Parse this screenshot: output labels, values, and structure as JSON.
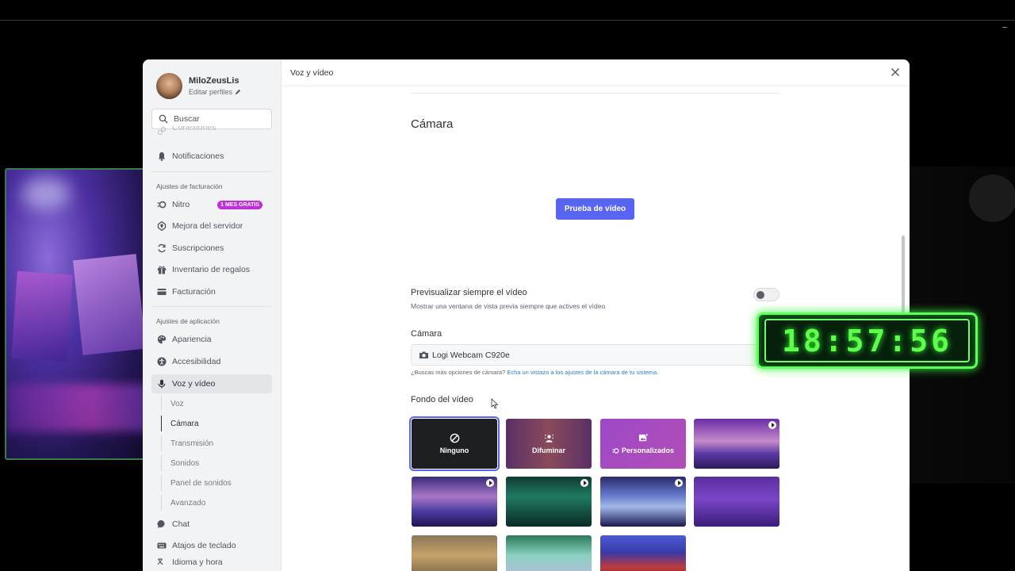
{
  "clock": {
    "time": "18:57:56"
  },
  "profile": {
    "name": "MiloZeusLis",
    "edit_label": "Editar perfiles"
  },
  "search": {
    "placeholder": "Buscar"
  },
  "sidebar": {
    "partial_item": "Conexiones",
    "notifications": "Notificaciones",
    "billing_section": "Ajustes de facturación",
    "billing_items": [
      {
        "label": "Nitro",
        "badge": "1 MES GRATIS"
      },
      {
        "label": "Mejora del servidor"
      },
      {
        "label": "Suscripciones"
      },
      {
        "label": "Inventario de regalos"
      },
      {
        "label": "Facturación"
      }
    ],
    "app_section": "Ajustes de aplicación",
    "app_items": [
      {
        "label": "Apariencia"
      },
      {
        "label": "Accesibilidad"
      },
      {
        "label": "Voz y vídeo"
      }
    ],
    "sub_items": [
      "Voz",
      "Cámara",
      "Transmisión",
      "Sonidos",
      "Panel de sonidos",
      "Avanzado"
    ],
    "more_items": [
      "Chat",
      "Atajos de teclado",
      "Idioma y hora"
    ]
  },
  "content": {
    "header": "Voz y vídeo",
    "camera_title": "Cámara",
    "test_button": "Prueba de vídeo",
    "preview_always_title": "Previsualizar siempre el vídeo",
    "preview_always_desc": "Mostrar una ventana de vista previa siempre que actives el vídeo",
    "preview_always_on": false,
    "camera_label": "Cámara",
    "camera_value": "Logi Webcam C920e",
    "hint_text": "¿Buscas más opciones de cámara?",
    "hint_link": "Echa un vistazo a los ajustes de la cámara de tu sistema.",
    "background_label": "Fondo del vídeo",
    "backgrounds": [
      {
        "label": "Ninguno",
        "selected": true
      },
      {
        "label": "Difuminar"
      },
      {
        "label": "Personalizados"
      }
    ]
  },
  "colors": {
    "accent": "#5865f2",
    "nitro_badge": "#c02fd9",
    "clock_green": "#5dff4a"
  }
}
